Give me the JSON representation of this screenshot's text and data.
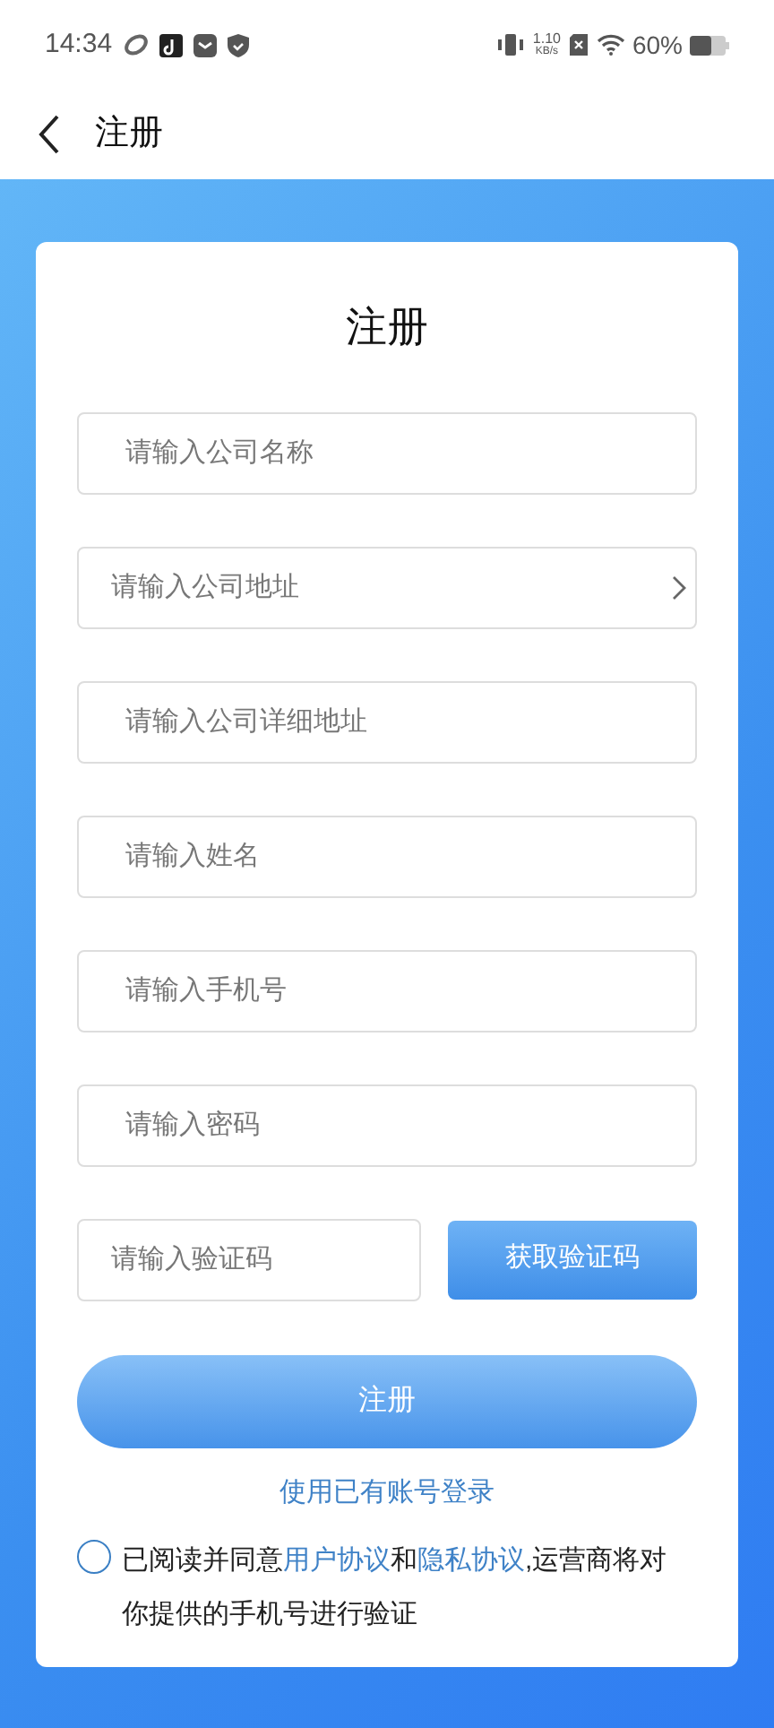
{
  "status_bar": {
    "time": "14:34",
    "speed_value": "1.10",
    "speed_unit": "KB/s",
    "battery": "60%"
  },
  "header": {
    "title": "注册"
  },
  "form": {
    "title": "注册",
    "fields": [
      {
        "kind": "text",
        "placeholder": "请输入公司名称"
      },
      {
        "kind": "select",
        "placeholder": "请输入公司地址"
      },
      {
        "kind": "text",
        "placeholder": "请输入公司详细地址"
      },
      {
        "kind": "text",
        "placeholder": "请输入姓名"
      },
      {
        "kind": "text",
        "placeholder": "请输入手机号"
      },
      {
        "kind": "text",
        "placeholder": "请输入密码"
      }
    ],
    "code_field": {
      "placeholder": "请输入验证码"
    },
    "code_button": "获取验证码",
    "submit_button": "注册",
    "login_link": "使用已有账号登录",
    "agreement": {
      "checked": false,
      "parts": [
        {
          "kind": "text",
          "text": "已阅读并同意"
        },
        {
          "kind": "link",
          "text": "用户协议"
        },
        {
          "kind": "text",
          "text": "和"
        },
        {
          "kind": "link",
          "text": "隐私协议"
        },
        {
          "kind": "text",
          "text": ",运营商将对你提供的手机号进行验证"
        }
      ]
    }
  }
}
